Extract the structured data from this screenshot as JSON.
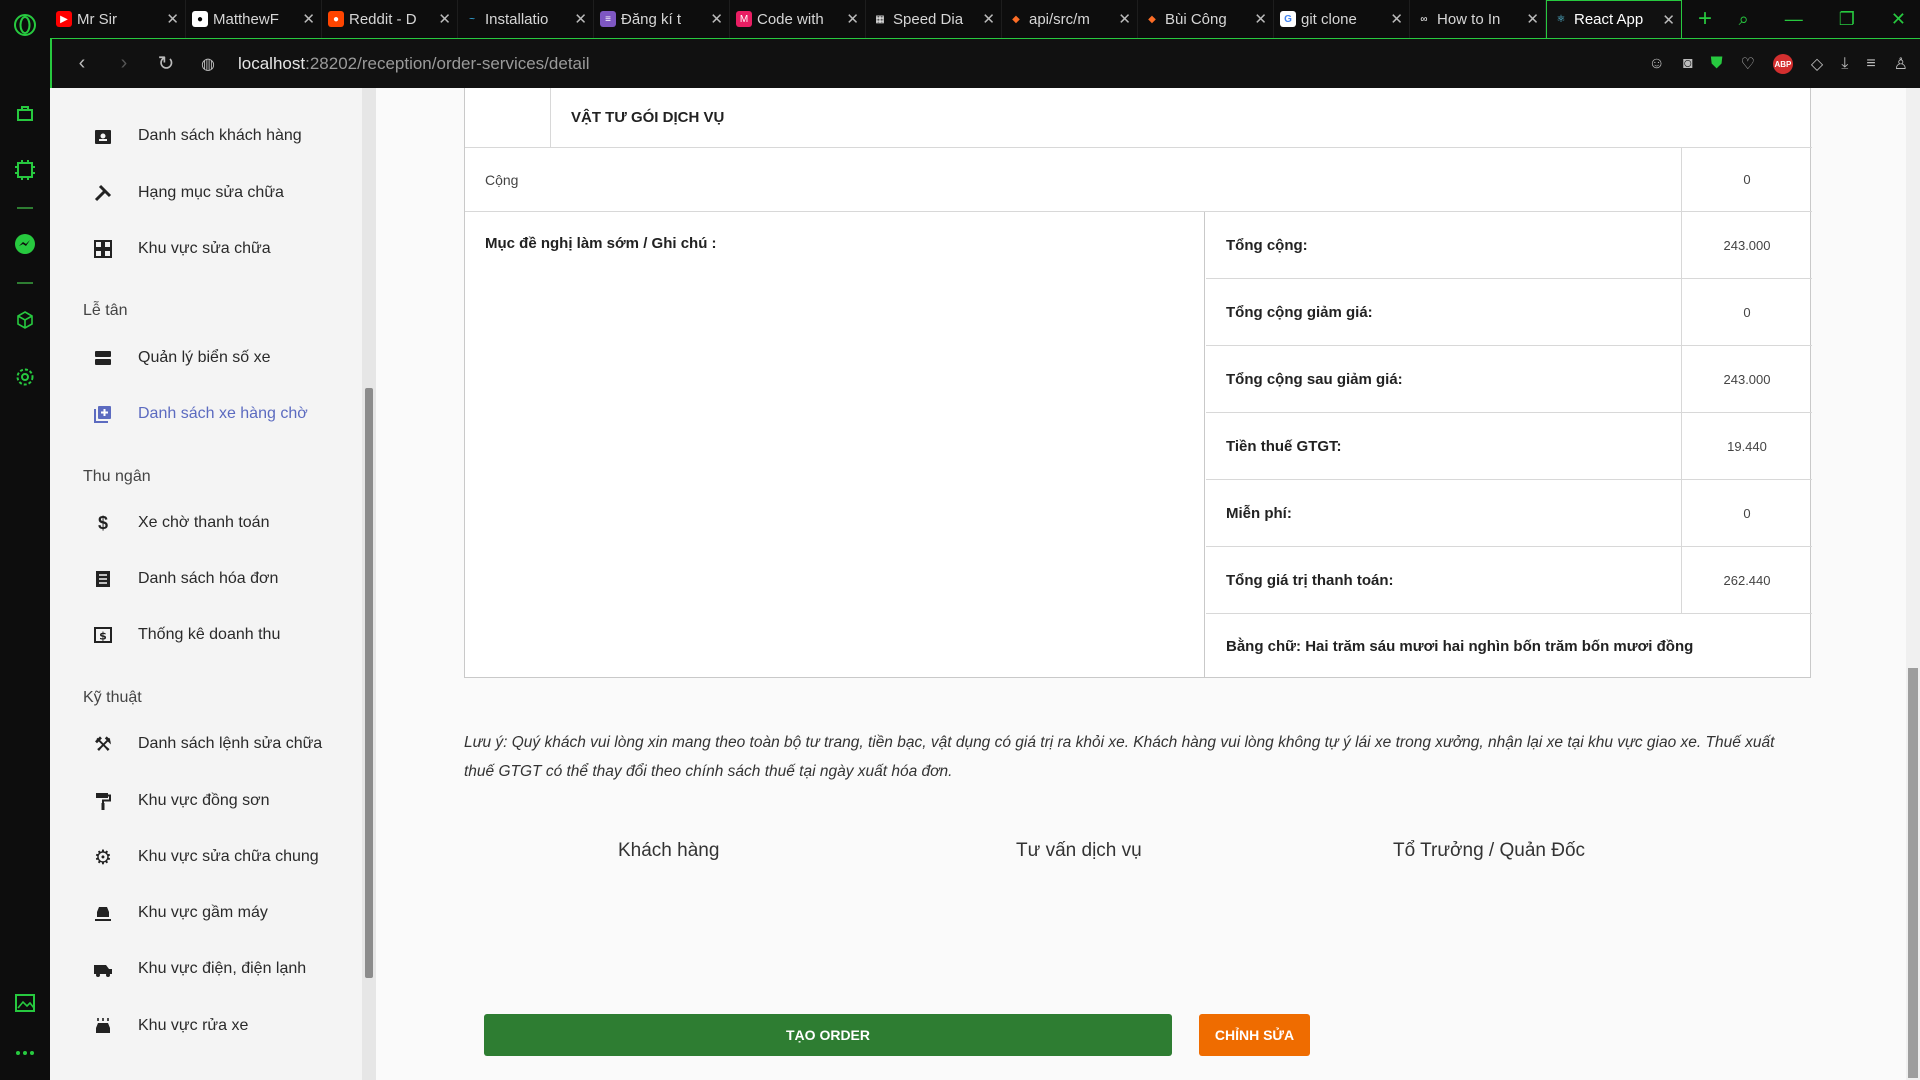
{
  "browser": {
    "tabs": [
      {
        "title": "Mr Sir",
        "fav_color": "#ff0000",
        "fav": "▶"
      },
      {
        "title": "MatthewF",
        "fav_color": "#333333",
        "fav": "●"
      },
      {
        "title": "Reddit - D",
        "fav_color": "#ff4500",
        "fav": "●"
      },
      {
        "title": "Installatio",
        "fav_color": "#38bdf8",
        "fav": "~"
      },
      {
        "title": "Đăng kí t",
        "fav_color": "#7e57c2",
        "fav": "≡"
      },
      {
        "title": "Code with",
        "fav_color": "#e91e63",
        "fav": "M"
      },
      {
        "title": "Speed Dia",
        "fav_color": "#444444",
        "fav": "▦"
      },
      {
        "title": "api/src/m",
        "fav_color": "#fc6d26",
        "fav": "◆"
      },
      {
        "title": "Bùi Công",
        "fav_color": "#fc6d26",
        "fav": "◆"
      },
      {
        "title": "git clone",
        "fav_color": "#4285f4",
        "fav": "G"
      },
      {
        "title": "How to In",
        "fav_color": "#333333",
        "fav": "∞"
      },
      {
        "title": "React App",
        "fav_color": "#61dafb",
        "fav": "⚛"
      }
    ],
    "url_host": "localhost",
    "url_path": ":28202/reception/order-services/detail"
  },
  "sidebar": {
    "items_top": [
      {
        "label": "Danh sách khách hàng",
        "icon": "contact-icon",
        "glyph": "▣"
      },
      {
        "label": "Hạng mục sửa chữa",
        "icon": "tools-icon",
        "glyph": "✖"
      },
      {
        "label": "Khu vực sửa chữa",
        "icon": "grid-icon",
        "glyph": "▦"
      }
    ],
    "section_reception": "Lễ tân",
    "items_reception": [
      {
        "label": "Quản lý biển số xe",
        "icon": "storage-icon",
        "glyph": "▬"
      },
      {
        "label": "Danh sách xe hàng chờ",
        "icon": "add-box-icon",
        "glyph": "⊞"
      }
    ],
    "section_cashier": "Thu ngân",
    "items_cashier": [
      {
        "label": "Xe chờ thanh toán",
        "icon": "price-change-icon",
        "glyph": "$"
      },
      {
        "label": "Danh sách hóa đơn",
        "icon": "list-icon",
        "glyph": "☰"
      },
      {
        "label": "Thống kê doanh thu",
        "icon": "dollar-box-icon",
        "glyph": "$"
      }
    ],
    "section_tech": "Kỹ thuật",
    "items_tech": [
      {
        "label": "Danh sách lệnh sửa chữa",
        "icon": "wrench-icon",
        "glyph": "⚒"
      },
      {
        "label": "Khu vực đồng sơn",
        "icon": "paint-roller-icon",
        "glyph": "⊤"
      },
      {
        "label": "Khu vực sửa chữa chung",
        "icon": "garage-icon",
        "glyph": "⚙"
      },
      {
        "label": "Khu vực gầm máy",
        "icon": "car-lift-icon",
        "glyph": "⊟"
      },
      {
        "label": "Khu vực điện, điện lạnh",
        "icon": "car-electric-icon",
        "glyph": "⚡"
      },
      {
        "label": "Khu vực rửa xe",
        "icon": "car-wash-icon",
        "glyph": "⊡"
      }
    ]
  },
  "detail": {
    "materials_title": "VẬT TƯ GÓI DỊCH VỤ",
    "sum_label": "Cộng",
    "sum_value": "0",
    "note_label": "Mục đề nghị làm sớm / Ghi chú :",
    "totals": [
      {
        "label": "Tổng cộng:",
        "value": "243.000"
      },
      {
        "label": "Tổng cộng giảm giá:",
        "value": "0"
      },
      {
        "label": "Tổng cộng sau giảm giá:",
        "value": "243.000"
      },
      {
        "label": "Tiền thuế GTGT:",
        "value": "19.440"
      },
      {
        "label": "Miễn phí:",
        "value": "0"
      },
      {
        "label": "Tổng giá trị thanh toán:",
        "value": "262.440"
      }
    ],
    "in_words": "Bằng chữ: Hai trăm sáu mươi hai nghìn bốn trăm bốn mươi đồng"
  },
  "notice": "Lưu ý: Quý khách vui lòng xin mang theo toàn bộ tư trang, tiền bạc, vật dụng có giá trị ra khỏi xe. Khách hàng vui lòng không tự ý lái xe trong xưởng, nhận lại xe tại khu vực giao xe. Thuế xuất thuế GTGT có thể thay đổi theo chính sách thuế tại ngày xuất hóa đơn.",
  "signatures": [
    "Khách hàng",
    "Tư vấn dịch vụ",
    "Tổ Trưởng / Quản Đốc"
  ],
  "buttons": {
    "create_order": "TẠO ORDER",
    "edit": "CHỈNH SỬA"
  }
}
